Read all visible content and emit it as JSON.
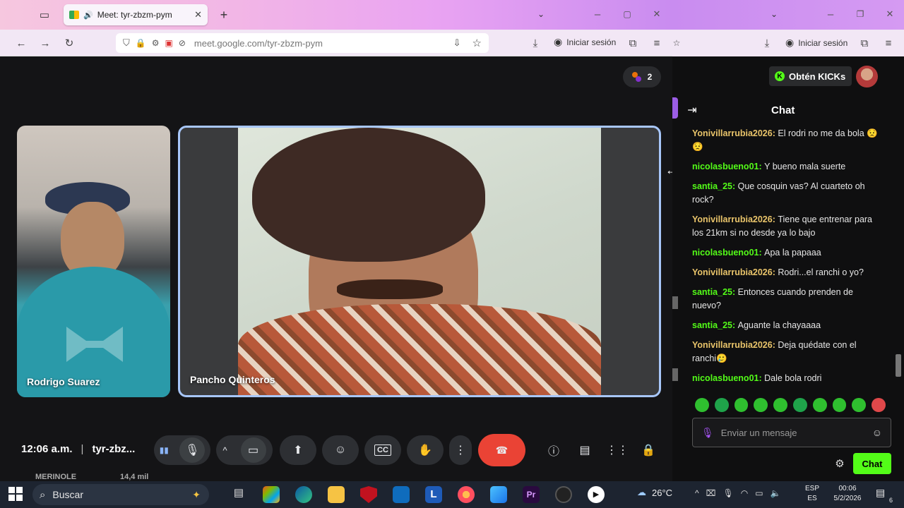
{
  "left_browser": {
    "tab_title": "Meet: tyr-zbzm-pym",
    "url": "meet.google.com/tyr-zbzm-pym",
    "signin_label": "Iniciar sesión"
  },
  "meet": {
    "participant_count": "2",
    "participants": [
      {
        "name": "Rodrigo Suarez"
      },
      {
        "name": "Pancho Quinteros"
      }
    ],
    "time": "12:06 a.m.",
    "separator": "|",
    "meeting_code": "tyr-zbz...",
    "bottom_overlay_text": "MERINOLE",
    "bottom_overlay_text2": "14,4 mil"
  },
  "right_browser": {
    "signin_label": "Iniciar sesión",
    "kicks_label": "Obtén KICKs"
  },
  "chat": {
    "title": "Chat",
    "input_placeholder": "Enviar un mensaje",
    "send_label": "Chat",
    "messages": [
      {
        "user": "Yonivillarrubia2026",
        "color": "yellow",
        "text": "El rodri no me da bola 😟😟"
      },
      {
        "user": "nicolasbueno01",
        "color": "green",
        "text": "Y bueno mala suerte"
      },
      {
        "user": "santia_25",
        "color": "green",
        "text": "Que cosquin vas? Al cuarteto oh rock?"
      },
      {
        "user": "Yonivillarrubia2026",
        "color": "yellow",
        "text": "Tiene que entrenar para los 21km si no desde ya lo bajo"
      },
      {
        "user": "nicolasbueno01",
        "color": "green",
        "text": "Apa la papaaa"
      },
      {
        "user": "Yonivillarrubia2026",
        "color": "yellow",
        "text": "Rodri...el ranchi o yo?"
      },
      {
        "user": "santia_25",
        "color": "green",
        "text": "Entonces cuando prenden de nuevo?"
      },
      {
        "user": "santia_25",
        "color": "green",
        "text": "Aguante la chayaaaa"
      },
      {
        "user": "Yonivillarrubia2026",
        "color": "yellow",
        "text": "Deja quédate con el ranchi🥲"
      },
      {
        "user": "nicolasbueno01",
        "color": "green",
        "text": "Dale bola rodri"
      }
    ]
  },
  "taskbar": {
    "search_label": "Buscar",
    "temperature": "26°C",
    "lang_top": "ESP",
    "lang_bottom": "ES",
    "clock_time": "00:06",
    "clock_date": "5/2/2026",
    "notif_count": "6"
  },
  "colors": {
    "kick_green": "#53fc18",
    "end_call_red": "#ea4335",
    "speaker_border": "#a8c7fa"
  }
}
